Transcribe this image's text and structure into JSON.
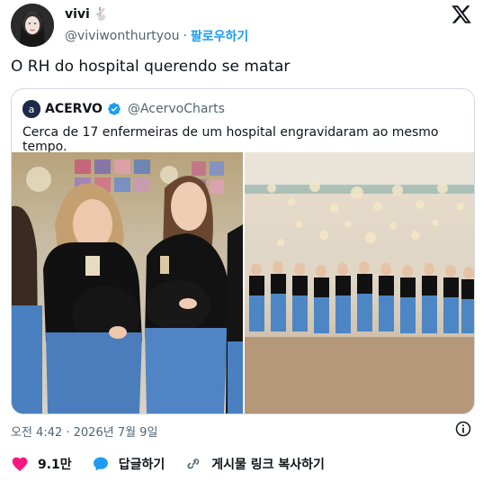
{
  "author": {
    "display_name": "vivi",
    "name_emoji": "🐇",
    "handle": "@viviwonthurtyou",
    "separator": "·",
    "follow_label": "팔로우하기"
  },
  "tweet": {
    "text": "O RH do hospital querendo se matar"
  },
  "quote": {
    "avatar_text": "a",
    "name": "ACERVO",
    "handle": "@AcervoCharts",
    "text": "Cerca de 17 enfermeiras de um hospital engravidaram ao mesmo tempo."
  },
  "meta": {
    "timestamp": "오전 4:42 · 2026년 7월 9일"
  },
  "actions": {
    "like_count": "9.1만",
    "reply_label": "답글하기",
    "copy_link_label": "게시물 링크 복사하기"
  },
  "colors": {
    "accent": "#1d9bf0",
    "like": "#f91880",
    "verified": "#1d9bf0",
    "text_secondary": "#536471"
  }
}
